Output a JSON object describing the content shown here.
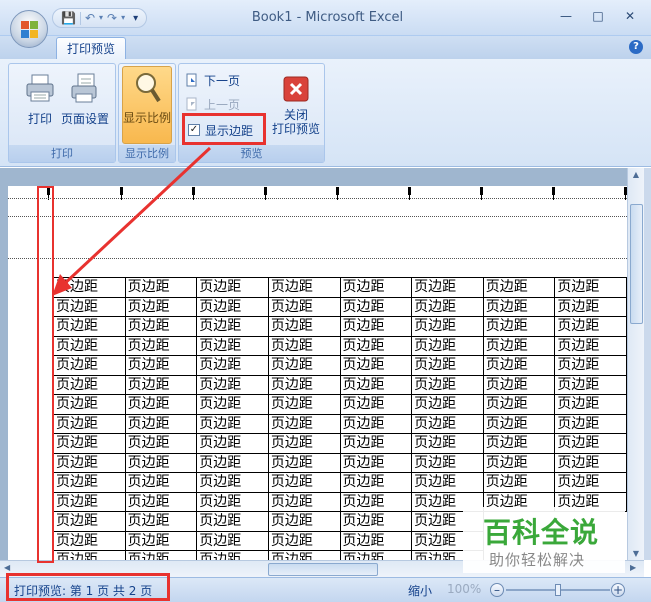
{
  "window": {
    "title": "Book1 - Microsoft Excel"
  },
  "quick_access": {
    "save_icon": "save-icon",
    "undo_icon": "undo-icon",
    "redo_icon": "redo-icon"
  },
  "ribbon": {
    "active_tab": "打印预览",
    "groups": {
      "print": {
        "label": "打印",
        "print_button": "打印",
        "page_setup_button": "页面设置"
      },
      "zoom": {
        "label": "显示比例",
        "zoom_button": "显示比例"
      },
      "preview": {
        "label": "预览",
        "next_page": "下一页",
        "prev_page": "上一页",
        "show_margins": "显示边距",
        "show_margins_checked": true,
        "close_line1": "关闭",
        "close_line2": "打印预览"
      }
    }
  },
  "sheet": {
    "cell_text": "页边距",
    "columns": 8,
    "rows_full": 12,
    "rows_partial": 3,
    "partial_columns": 6
  },
  "status_bar": {
    "text": "打印预览: 第 1 页  共 2 页",
    "zoom_out": "缩小",
    "zoom_percent": "100%"
  },
  "watermark": {
    "main": "百科全说",
    "sub": "助你轻松解决"
  },
  "colors": {
    "annotation": "#e8322f",
    "ribbon_text": "#15428b"
  }
}
